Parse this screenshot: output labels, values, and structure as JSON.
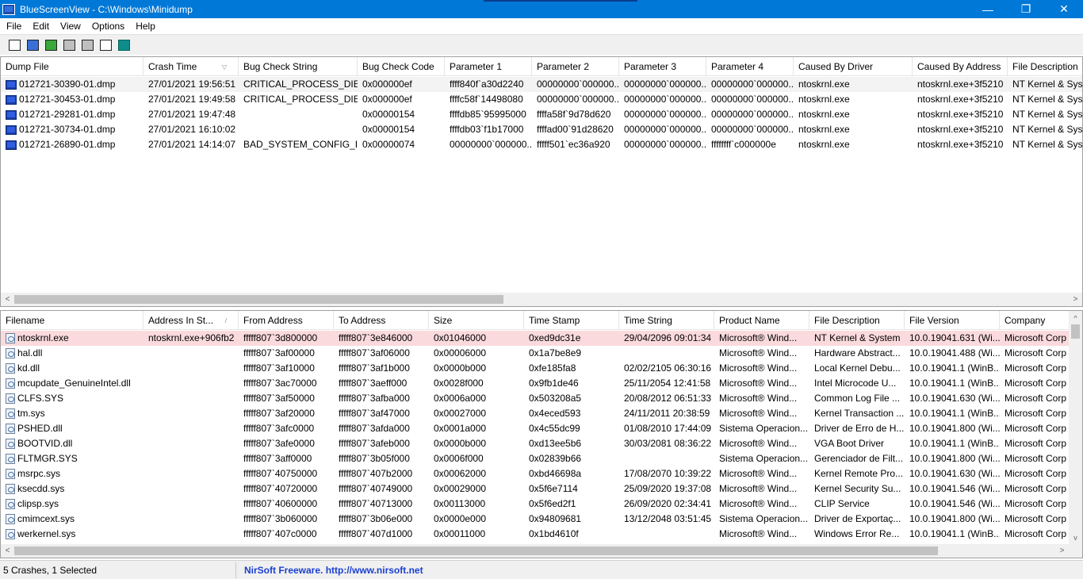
{
  "window": {
    "app_name": "BlueScreenView",
    "title_separator": " - ",
    "path": "C:\\Windows\\Minidump",
    "minimize": "—",
    "restore": "❐",
    "close": "✕"
  },
  "menu": [
    "File",
    "Edit",
    "View",
    "Options",
    "Help"
  ],
  "toolbar": [
    {
      "name": "html-report-icon"
    },
    {
      "name": "save-icon"
    },
    {
      "name": "refresh-icon"
    },
    {
      "name": "copy-icon"
    },
    {
      "name": "properties-icon"
    },
    {
      "name": "find-icon"
    },
    {
      "name": "exit-icon"
    }
  ],
  "crash_list": {
    "columns": [
      {
        "label": "Dump File"
      },
      {
        "label": "Crash Time",
        "sort": "▽"
      },
      {
        "label": "Bug Check String"
      },
      {
        "label": "Bug Check Code"
      },
      {
        "label": "Parameter 1"
      },
      {
        "label": "Parameter 2"
      },
      {
        "label": "Parameter 3"
      },
      {
        "label": "Parameter 4"
      },
      {
        "label": "Caused By Driver"
      },
      {
        "label": "Caused By Address"
      },
      {
        "label": "File Description"
      }
    ],
    "rows": [
      {
        "cells": [
          "012721-30390-01.dmp",
          "27/01/2021 19:56:51",
          "CRITICAL_PROCESS_DIED",
          "0x000000ef",
          "ffff840f`a30d2240",
          "00000000`000000...",
          "00000000`000000...",
          "00000000`000000...",
          "ntoskrnl.exe",
          "ntoskrnl.exe+3f5210",
          "NT Kernel & Syst"
        ],
        "selected": true
      },
      {
        "cells": [
          "012721-30453-01.dmp",
          "27/01/2021 19:49:58",
          "CRITICAL_PROCESS_DIED",
          "0x000000ef",
          "ffffc58f`14498080",
          "00000000`000000...",
          "00000000`000000...",
          "00000000`000000...",
          "ntoskrnl.exe",
          "ntoskrnl.exe+3f5210",
          "NT Kernel & Syst"
        ]
      },
      {
        "cells": [
          "012721-29281-01.dmp",
          "27/01/2021 19:47:48",
          "",
          "0x00000154",
          "ffffdb85`95995000",
          "ffffa58f`9d78d620",
          "00000000`000000...",
          "00000000`000000...",
          "ntoskrnl.exe",
          "ntoskrnl.exe+3f5210",
          "NT Kernel & Syst"
        ]
      },
      {
        "cells": [
          "012721-30734-01.dmp",
          "27/01/2021 16:10:02",
          "",
          "0x00000154",
          "ffffdb03`f1b17000",
          "ffffad00`91d28620",
          "00000000`000000...",
          "00000000`000000...",
          "ntoskrnl.exe",
          "ntoskrnl.exe+3f5210",
          "NT Kernel & Syst"
        ]
      },
      {
        "cells": [
          "012721-26890-01.dmp",
          "27/01/2021 14:14:07",
          "BAD_SYSTEM_CONFIG_I...",
          "0x00000074",
          "00000000`000000...",
          "fffff501`ec36a920",
          "00000000`000000...",
          "ffffffff`c000000e",
          "ntoskrnl.exe",
          "ntoskrnl.exe+3f5210",
          "NT Kernel & Syst"
        ]
      }
    ]
  },
  "driver_list": {
    "columns": [
      {
        "label": "Filename"
      },
      {
        "label": "Address In St...",
        "sort": "/"
      },
      {
        "label": "From Address"
      },
      {
        "label": "To Address"
      },
      {
        "label": "Size"
      },
      {
        "label": "Time Stamp"
      },
      {
        "label": "Time String"
      },
      {
        "label": "Product Name"
      },
      {
        "label": "File Description"
      },
      {
        "label": "File Version"
      },
      {
        "label": "Company"
      }
    ],
    "rows": [
      {
        "cells": [
          "ntoskrnl.exe",
          "ntoskrnl.exe+906fb2",
          "fffff807`3d800000",
          "fffff807`3e846000",
          "0x01046000",
          "0xed9dc31e",
          "29/04/2096 09:01:34",
          "Microsoft® Wind...",
          "NT Kernel & System",
          "10.0.19041.631 (Wi...",
          "Microsoft Corp"
        ],
        "highlighted": true
      },
      {
        "cells": [
          "hal.dll",
          "",
          "fffff807`3af00000",
          "fffff807`3af06000",
          "0x00006000",
          "0x1a7be8e9",
          "",
          "Microsoft® Wind...",
          "Hardware Abstract...",
          "10.0.19041.488 (Wi...",
          "Microsoft Corp"
        ]
      },
      {
        "cells": [
          "kd.dll",
          "",
          "fffff807`3af10000",
          "fffff807`3af1b000",
          "0x0000b000",
          "0xfe185fa8",
          "02/02/2105 06:30:16",
          "Microsoft® Wind...",
          "Local Kernel Debu...",
          "10.0.19041.1 (WinB...",
          "Microsoft Corp"
        ]
      },
      {
        "cells": [
          "mcupdate_GenuineIntel.dll",
          "",
          "fffff807`3ac70000",
          "fffff807`3aeff000",
          "0x0028f000",
          "0x9fb1de46",
          "25/11/2054 12:41:58",
          "Microsoft® Wind...",
          "Intel Microcode U...",
          "10.0.19041.1 (WinB...",
          "Microsoft Corp"
        ]
      },
      {
        "cells": [
          "CLFS.SYS",
          "",
          "fffff807`3af50000",
          "fffff807`3afba000",
          "0x0006a000",
          "0x503208a5",
          "20/08/2012 06:51:33",
          "Microsoft® Wind...",
          "Common Log File ...",
          "10.0.19041.630 (Wi...",
          "Microsoft Corp"
        ]
      },
      {
        "cells": [
          "tm.sys",
          "",
          "fffff807`3af20000",
          "fffff807`3af47000",
          "0x00027000",
          "0x4eced593",
          "24/11/2011 20:38:59",
          "Microsoft® Wind...",
          "Kernel Transaction ...",
          "10.0.19041.1 (WinB...",
          "Microsoft Corp"
        ]
      },
      {
        "cells": [
          "PSHED.dll",
          "",
          "fffff807`3afc0000",
          "fffff807`3afda000",
          "0x0001a000",
          "0x4c55dc99",
          "01/08/2010 17:44:09",
          "Sistema Operacion...",
          "Driver de Erro de H...",
          "10.0.19041.800 (Wi...",
          "Microsoft Corp"
        ]
      },
      {
        "cells": [
          "BOOTVID.dll",
          "",
          "fffff807`3afe0000",
          "fffff807`3afeb000",
          "0x0000b000",
          "0xd13ee5b6",
          "30/03/2081 08:36:22",
          "Microsoft® Wind...",
          "VGA Boot Driver",
          "10.0.19041.1 (WinB...",
          "Microsoft Corp"
        ]
      },
      {
        "cells": [
          "FLTMGR.SYS",
          "",
          "fffff807`3aff0000",
          "fffff807`3b05f000",
          "0x0006f000",
          "0x02839b66",
          "",
          "Sistema Operacion...",
          "Gerenciador de Filt...",
          "10.0.19041.800 (Wi...",
          "Microsoft Corp"
        ]
      },
      {
        "cells": [
          "msrpc.sys",
          "",
          "fffff807`40750000",
          "fffff807`407b2000",
          "0x00062000",
          "0xbd46698a",
          "17/08/2070 10:39:22",
          "Microsoft® Wind...",
          "Kernel Remote Pro...",
          "10.0.19041.630 (Wi...",
          "Microsoft Corp"
        ]
      },
      {
        "cells": [
          "ksecdd.sys",
          "",
          "fffff807`40720000",
          "fffff807`40749000",
          "0x00029000",
          "0x5f6e7114",
          "25/09/2020 19:37:08",
          "Microsoft® Wind...",
          "Kernel Security Su...",
          "10.0.19041.546 (Wi...",
          "Microsoft Corp"
        ]
      },
      {
        "cells": [
          "clipsp.sys",
          "",
          "fffff807`40600000",
          "fffff807`40713000",
          "0x00113000",
          "0x5f6ed2f1",
          "26/09/2020 02:34:41",
          "Microsoft® Wind...",
          "CLIP Service",
          "10.0.19041.546 (Wi...",
          "Microsoft Corp"
        ]
      },
      {
        "cells": [
          "cmimcext.sys",
          "",
          "fffff807`3b060000",
          "fffff807`3b06e000",
          "0x0000e000",
          "0x94809681",
          "13/12/2048 03:51:45",
          "Sistema Operacion...",
          "Driver de Exportaç...",
          "10.0.19041.800 (Wi...",
          "Microsoft Corp"
        ]
      },
      {
        "cells": [
          "werkernel.sys",
          "",
          "fffff807`407c0000",
          "fffff807`407d1000",
          "0x00011000",
          "0x1bd4610f",
          "",
          "Microsoft® Wind...",
          "Windows Error Re...",
          "10.0.19041.1 (WinB...",
          "Microsoft Corp"
        ]
      }
    ]
  },
  "scroll": {
    "left": "<",
    "right": ">",
    "up": "^",
    "down": "v"
  },
  "status": {
    "count": "5 Crashes, 1 Selected",
    "link": "NirSoft Freeware.  http://www.nirsoft.net"
  }
}
